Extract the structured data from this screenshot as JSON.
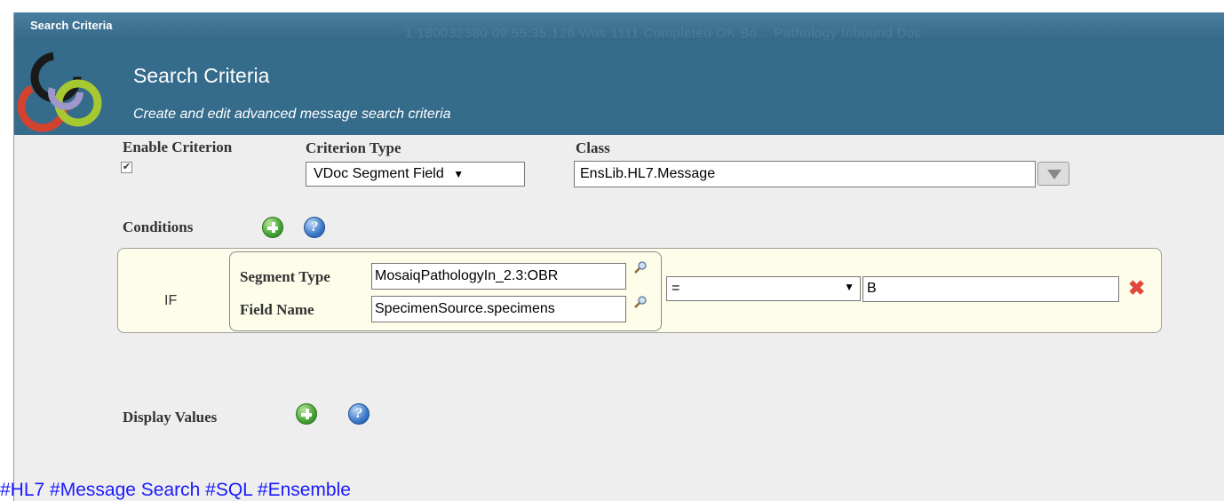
{
  "titlebar": {
    "label": "Search Criteria"
  },
  "background_row": {
    "text": "1   180032380   09:55:35.126   Was 1111   Completed   OK   Bo... Pathology Inbound   Doc"
  },
  "header": {
    "title": "Search Criteria",
    "subtitle": "Create and edit advanced message search criteria",
    "logo_icon": "ensemble-rings-logo",
    "colors": {
      "bar": "#356b8b",
      "titlebar": "#386d8d"
    }
  },
  "criterion": {
    "enable_label": "Enable Criterion",
    "enabled": true,
    "type_label": "Criterion Type",
    "type_value": "VDoc Segment Field",
    "class_label": "Class",
    "class_value": "EnsLib.HL7.Message"
  },
  "conditions": {
    "label": "Conditions",
    "add_icon": "plus-circle-icon",
    "help_icon": "help-icon",
    "rows": [
      {
        "if_label": "IF",
        "segment_type_label": "Segment Type",
        "segment_type_value": "MosaiqPathologyIn_2.3:OBR",
        "field_name_label": "Field Name",
        "field_name_value": "SpecimenSource.specimens",
        "operator": "=",
        "value": "B"
      }
    ]
  },
  "display_values": {
    "label": "Display Values"
  },
  "tags": "#HL7 #Message Search #SQL #Ensemble",
  "colors": {
    "delete": "#e0483e",
    "tags": "#1a1aff"
  }
}
